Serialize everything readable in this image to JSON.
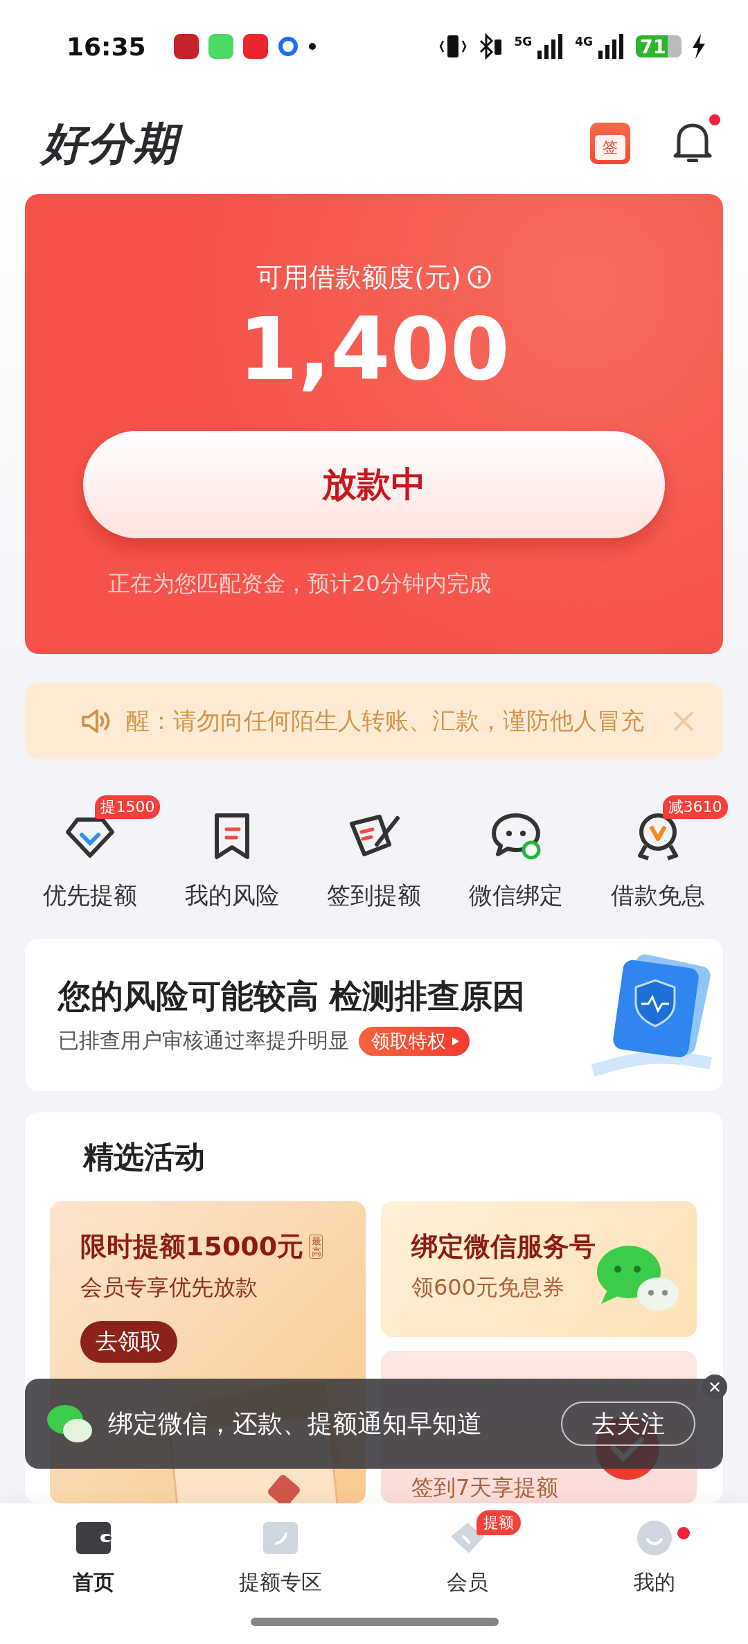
{
  "status_bar": {
    "time": "16:35",
    "network_1": "5G",
    "network_2": "4G",
    "battery": "71"
  },
  "header": {
    "logo": "好分期",
    "checkin_label": "签",
    "unread": true
  },
  "credit_card": {
    "label": "可用借款额度(元)",
    "amount": "1,400",
    "button": "放款中",
    "note": "正在为您匹配资金，预计20分钟内完成"
  },
  "notice": {
    "text": "醒：请勿向任何陌生人转账、汇款，谨防他人冒充"
  },
  "shortcuts": [
    {
      "kind": "diamond",
      "label": "优先提额",
      "badge": "提1500"
    },
    {
      "kind": "bookmark",
      "label": "我的风险"
    },
    {
      "kind": "sign",
      "label": "签到提额"
    },
    {
      "kind": "chat",
      "label": "微信绑定"
    },
    {
      "kind": "medal",
      "label": "借款免息",
      "badge": "减3610"
    }
  ],
  "risk_banner": {
    "title": "您的风险可能较高 检测排查原因",
    "subtitle": "已排查用户审核通过率提升明显",
    "button": "领取特权"
  },
  "activities": {
    "title": "精选活动",
    "cards": [
      {
        "kind": "vip",
        "title": "限时提额15000元",
        "tag": "最高",
        "subtitle": "会员专享优先放款",
        "button": "去领取"
      },
      {
        "kind": "wechat",
        "title": "绑定微信服务号",
        "subtitle": "领600元免息券"
      },
      {
        "kind": "checkin",
        "subtitle": "签到7天享提额"
      }
    ]
  },
  "toast": {
    "text": "绑定微信，还款、提额通知早知道",
    "button": "去关注"
  },
  "tab_bar": [
    {
      "kind": "wallet",
      "label": "首页",
      "selected": true
    },
    {
      "kind": "quota",
      "label": "提额专区",
      "selected": false
    },
    {
      "kind": "tag",
      "label": "会员",
      "selected": false,
      "badge": "提额"
    },
    {
      "kind": "face",
      "label": "我的",
      "selected": false,
      "dot": true
    }
  ]
}
